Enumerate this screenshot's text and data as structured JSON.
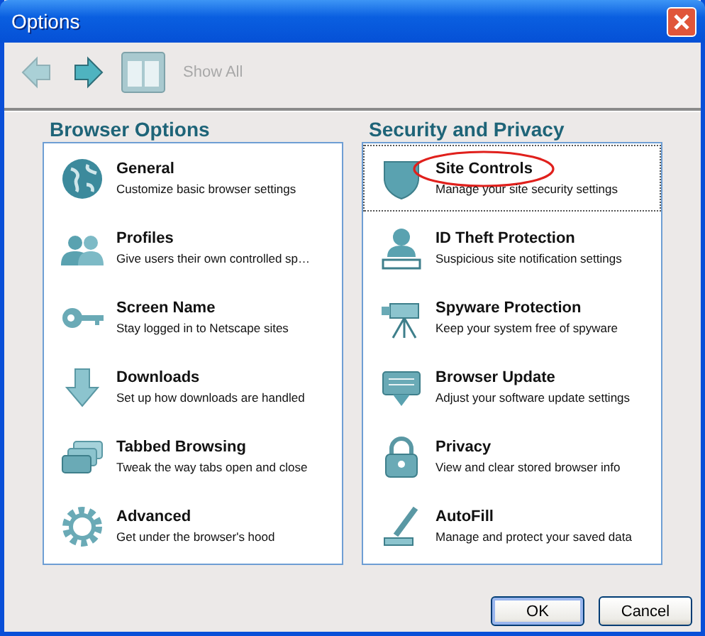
{
  "window": {
    "title": "Options"
  },
  "toolbar": {
    "back_disabled": true,
    "forward_disabled": false,
    "show_all": {
      "label": "Show All",
      "disabled": true
    }
  },
  "sections": [
    {
      "title": "Browser Options",
      "items": [
        {
          "title": "General",
          "description": "Customize basic browser settings",
          "selected": false
        },
        {
          "title": "Profiles",
          "description": "Give users their own controlled sp…",
          "selected": false
        },
        {
          "title": "Screen Name",
          "description": "Stay logged in to Netscape sites",
          "selected": false
        },
        {
          "title": "Downloads",
          "description": "Set up how downloads are handled",
          "selected": false
        },
        {
          "title": "Tabbed Browsing",
          "description": "Tweak the way tabs open and close",
          "selected": false
        },
        {
          "title": "Advanced",
          "description": "Get under the browser's hood",
          "selected": false
        }
      ]
    },
    {
      "title": "Security and Privacy",
      "items": [
        {
          "title": "Site Controls",
          "description": "Manage your site security settings",
          "selected": true
        },
        {
          "title": "ID Theft Protection",
          "description": "Suspicious site notification settings",
          "selected": false
        },
        {
          "title": "Spyware Protection",
          "description": "Keep your system free of spyware",
          "selected": false
        },
        {
          "title": "Browser Update",
          "description": "Adjust your software update settings",
          "selected": false
        },
        {
          "title": "Privacy",
          "description": "View and clear stored browser info",
          "selected": false
        },
        {
          "title": "AutoFill",
          "description": "Manage and protect your saved data",
          "selected": false
        }
      ]
    }
  ],
  "buttons": [
    {
      "label": "OK",
      "default": true
    },
    {
      "label": "Cancel",
      "default": false
    }
  ]
}
